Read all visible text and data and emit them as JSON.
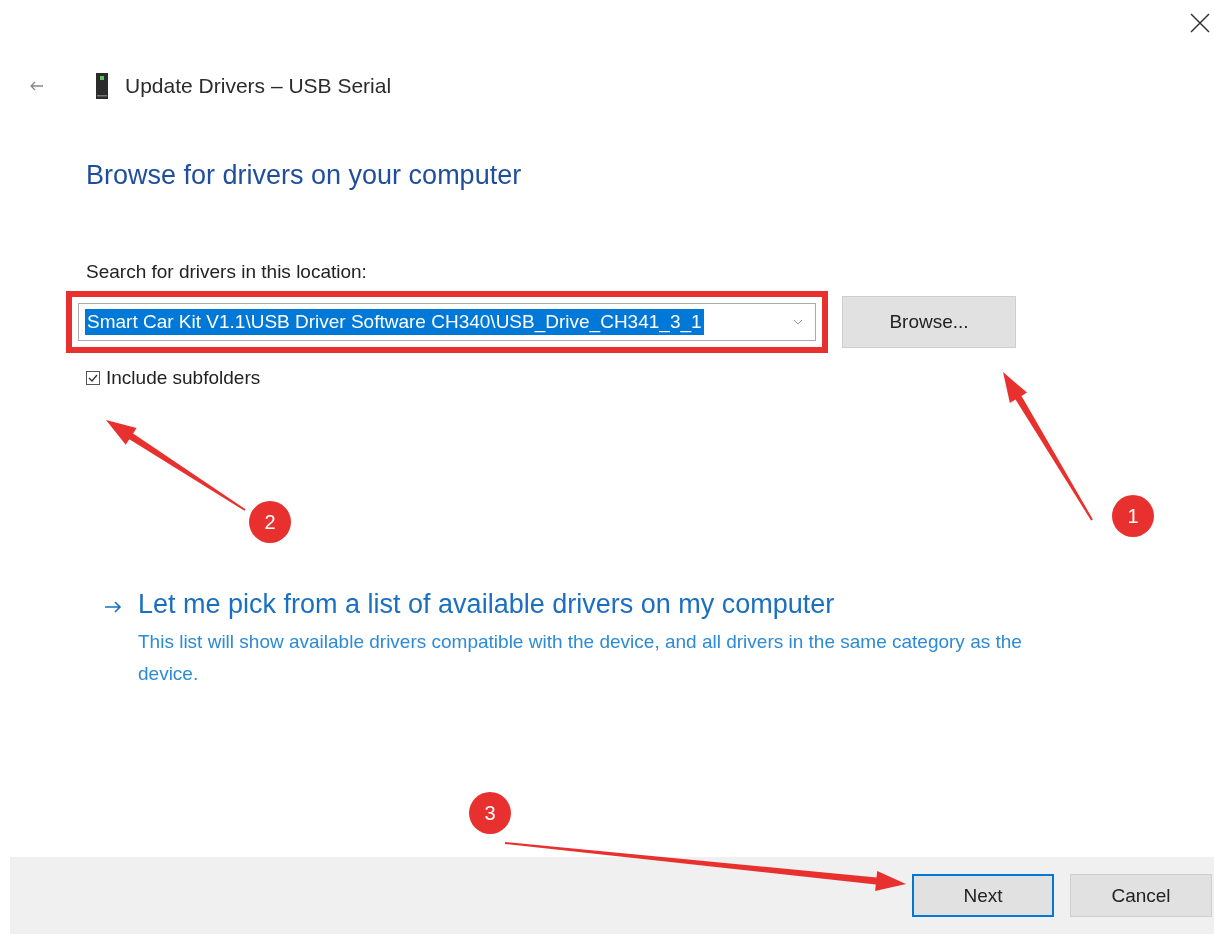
{
  "window": {
    "title": "Update Drivers – USB Serial"
  },
  "heading": "Browse for drivers on your computer",
  "location": {
    "label": "Search for drivers in this location:",
    "value": "Smart Car Kit V1.1\\USB Driver Software CH340\\USB_Drive_CH341_3_1",
    "selected": true,
    "highlighted": true
  },
  "browse_button": "Browse...",
  "include_subfolders": {
    "label": "Include subfolders",
    "checked": true
  },
  "pick_link": {
    "title": "Let me pick from a list of available drivers on my computer",
    "description": "This list will show available drivers compatible with the device, and all drivers in the same category as the device."
  },
  "buttons": [
    {
      "label": "Next",
      "default": true
    },
    {
      "label": "Cancel",
      "default": false
    }
  ],
  "annotations": [
    {
      "number": "1"
    },
    {
      "number": "2"
    },
    {
      "number": "3"
    }
  ]
}
